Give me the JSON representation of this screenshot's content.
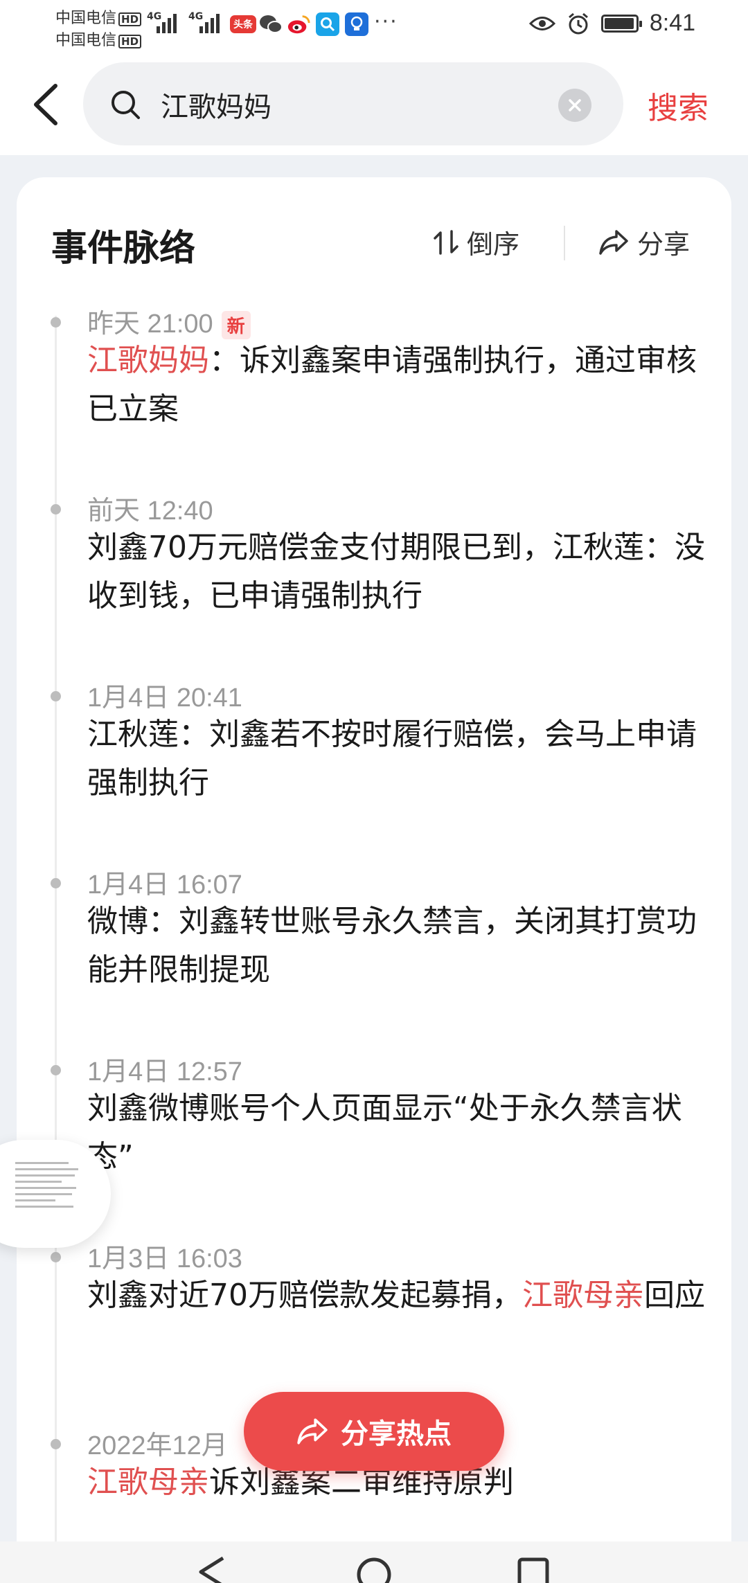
{
  "status_bar": {
    "carrier1": "中国电信",
    "carrier2": "中国电信",
    "hd": "HD",
    "network": "4G",
    "toutiao_label": "头条",
    "more": "···",
    "time": "8:41",
    "battery_level": 0.85
  },
  "header": {
    "search_value": "江歌妈妈",
    "search_button": "搜索"
  },
  "card": {
    "title": "事件脉络",
    "sort_label": "倒序",
    "share_label": "分享"
  },
  "timeline": [
    {
      "time": "昨天 21:00",
      "badge": "新",
      "highlight": "江歌妈妈",
      "text": "：诉刘鑫案申请强制执行，通过审核已立案"
    },
    {
      "time": "前天 12:40",
      "text": "刘鑫70万元赔偿金支付期限已到，江秋莲：没收到钱，已申请强制执行"
    },
    {
      "time": "1月4日 20:41",
      "text": "江秋莲：刘鑫若不按时履行赔偿，会马上申请强制执行"
    },
    {
      "time": "1月4日 16:07",
      "text": "微博：刘鑫转世账号永久禁言，关闭其打赏功能并限制提现"
    },
    {
      "time": "1月4日 12:57",
      "text": "刘鑫微博账号个人页面显示“处于永久禁言状态”"
    },
    {
      "time": "1月3日 16:03",
      "text": "刘鑫对近70万赔偿款发起募捐，",
      "highlight": "江歌母亲",
      "text_after": "回应"
    },
    {
      "time": "2022年12月",
      "highlight": "江歌母亲",
      "text": "诉刘鑫案二审维持原判"
    }
  ],
  "share_hot_label": "分享热点",
  "colors": {
    "accent": "#e84040",
    "highlight": "#e05050",
    "background": "#eef1f5"
  }
}
